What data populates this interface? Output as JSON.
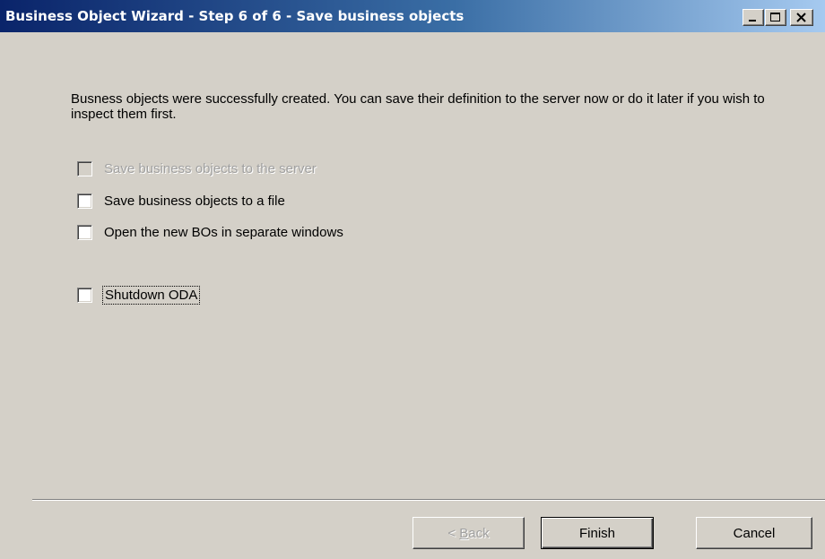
{
  "window": {
    "title": "Business Object Wizard - Step 6 of 6 - Save business objects"
  },
  "titlebar_buttons": {
    "minimize_icon": "minimize-icon",
    "maximize_icon": "maximize-icon",
    "close_icon": "close-icon"
  },
  "intro": {
    "text": "Busness objects were successfully created. You can save their definition to the server now or do it later if you wish to inspect them first."
  },
  "options": [
    {
      "label": "Save business objects to the server",
      "checked": false,
      "enabled": false
    },
    {
      "label": "Save business objects to a file",
      "checked": false,
      "enabled": true
    },
    {
      "label": "Open the new BOs in separate windows",
      "checked": false,
      "enabled": true
    },
    {
      "label": "Shutdown ODA",
      "checked": false,
      "enabled": true,
      "focused": true
    }
  ],
  "buttons": {
    "back_prefix": "< ",
    "back_mnemonic": "B",
    "back_rest": "ack",
    "finish": "Finish",
    "cancel": "Cancel"
  },
  "colors": {
    "titlebar_start": "#0a246a",
    "titlebar_end": "#a6caf0",
    "window_bg": "#d4d0c8",
    "disabled_text": "#a0a0a0"
  }
}
